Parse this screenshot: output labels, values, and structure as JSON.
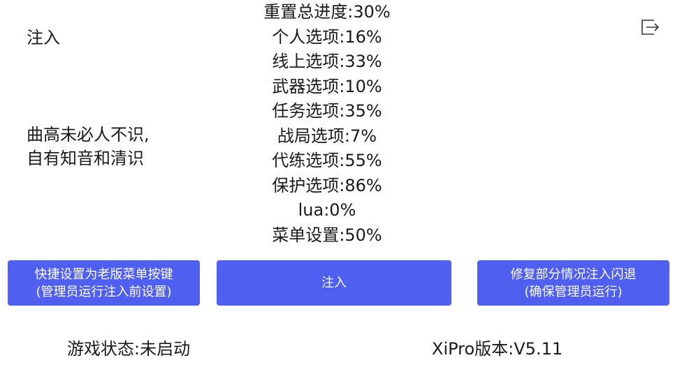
{
  "header": {
    "inject_label": "注入"
  },
  "poem": {
    "line1": "曲高未必人不识,",
    "line2": "自有知音和清识"
  },
  "progress": [
    "重置总进度:30%",
    "个人选项:16%",
    "线上选项:33%",
    "武器选项:10%",
    "任务选项:35%",
    "战局选项:7%",
    "代练选项:55%",
    "保护选项:86%",
    "lua:0%",
    "菜单设置:50%"
  ],
  "buttons": {
    "left_line1": "快捷设置为老版菜单按键",
    "left_line2": "(管理员运行注入前设置)",
    "inject": "注入",
    "right_line1": "修复部分情况注入闪退",
    "right_line2": "(确保管理员运行)"
  },
  "status": {
    "game_state": "游戏状态:未启动",
    "version": "XiPro版本:V5.11"
  },
  "icons": {
    "exit": "exit-icon"
  },
  "colors": {
    "button_bg": "#4f5ff0",
    "button_text": "#ffffff",
    "text": "#1a1a1a"
  }
}
